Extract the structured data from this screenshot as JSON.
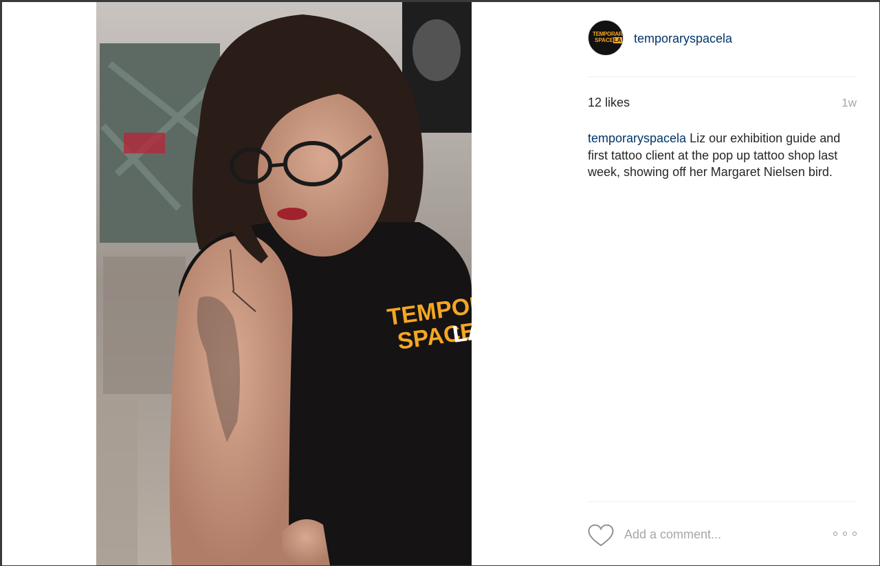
{
  "post": {
    "author": "temporaryspacela",
    "avatar_lines": [
      "TEMPORARY",
      "SPACE",
      "LA"
    ],
    "likes": "12 likes",
    "time_ago": "1w",
    "caption_user": "temporaryspacela",
    "caption_text": " Liz our exhibition guide and first tattoo client at the pop up tattoo shop last week, showing off her Margaret Nielsen bird.",
    "shirt_logo_lines": [
      "TEMPORARY",
      "SPACE",
      "LA"
    ]
  },
  "comment": {
    "placeholder": "Add a comment..."
  },
  "icons": {
    "like": "heart-icon",
    "more": "more-options-icon"
  },
  "colors": {
    "link": "#003569",
    "text": "#262626",
    "muted": "#a5a7aa",
    "brand_orange": "#f5a623"
  }
}
